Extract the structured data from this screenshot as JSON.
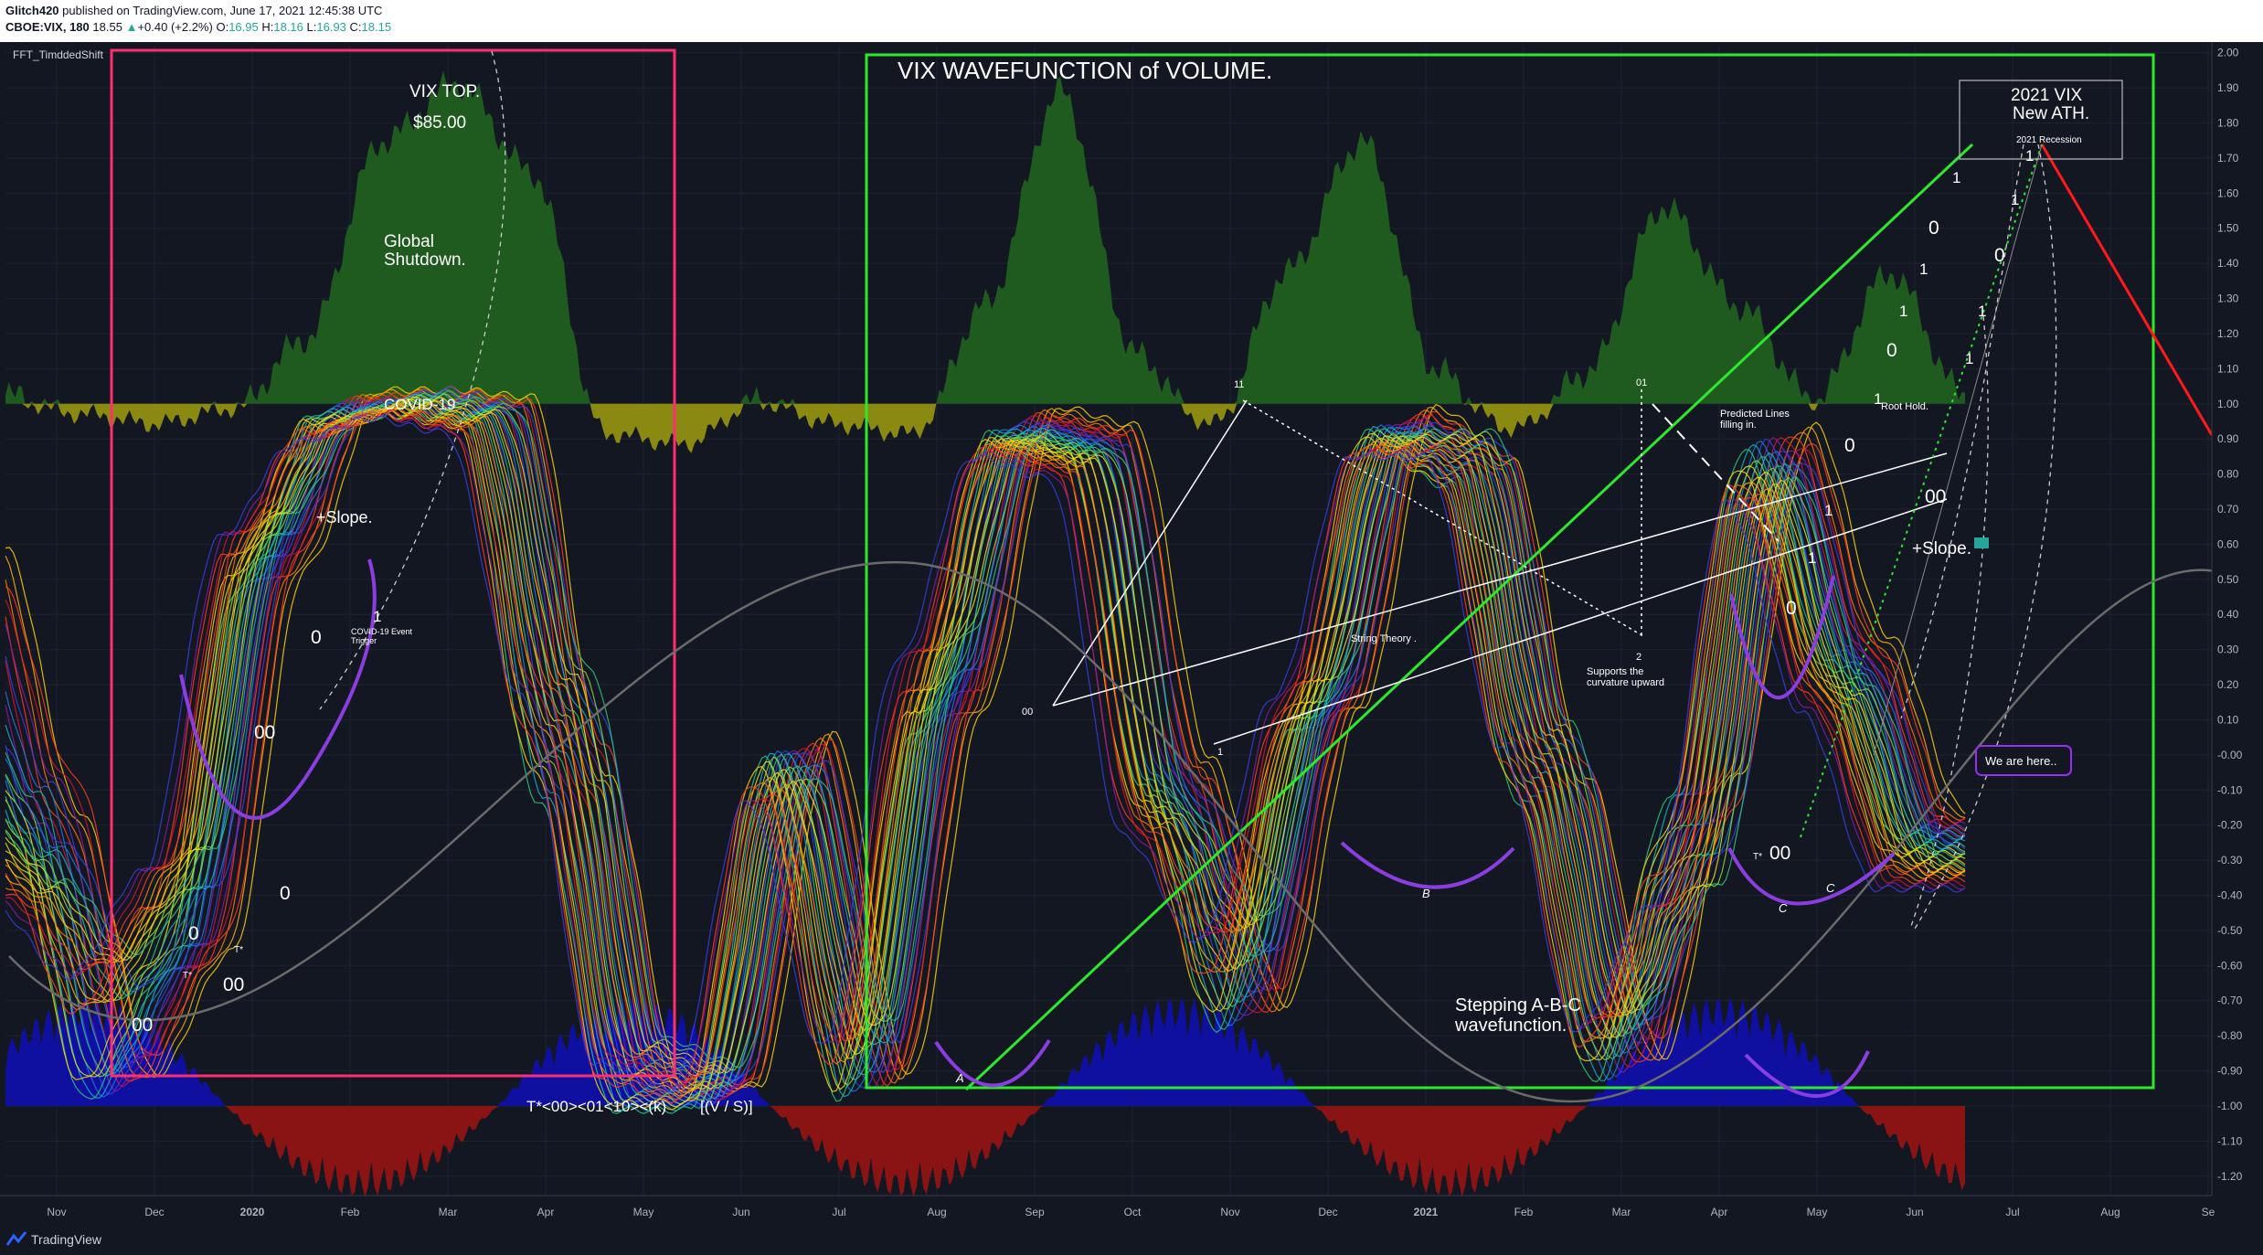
{
  "header": {
    "author": "Glitch420",
    "published": "published on TradingView.com, June 17, 2021 12:45:38 UTC",
    "symbol": "CBOE:VIX, 180",
    "price": "18.55",
    "change": "+0.40 (+2.2%)",
    "open_label": "O:",
    "open": "16.95",
    "high_label": "H:",
    "high": "18.16",
    "low_label": "L:",
    "low": "16.93",
    "close_label": "C:",
    "close": "18.15"
  },
  "indicator_label": "FFT_TimddedShift",
  "footer": {
    "brand": "TradingView"
  },
  "colors": {
    "background": "#131722",
    "pink_box": "#ff2e6f",
    "green_box": "#2ee82e",
    "volume_up": "#1f5a1f",
    "volume_down": "#8a8a12",
    "blue_area": "#1010a0",
    "red_area": "#8a1414",
    "red_line": "#ff1a1a",
    "purple": "#8a3ee0"
  },
  "chart_data": {
    "type": "line",
    "title": "",
    "xlabel": "",
    "ylabel": "",
    "x_ticks": [
      "Nov",
      "Dec",
      "2020",
      "Feb",
      "Mar",
      "Apr",
      "May",
      "Jun",
      "Jul",
      "Aug",
      "Sep",
      "Oct",
      "Nov",
      "Dec",
      "2021",
      "Feb",
      "Mar",
      "Apr",
      "May",
      "Jun",
      "Jul",
      "Aug",
      "Se"
    ],
    "y_ticks": [
      "2.00",
      "1.90",
      "1.80",
      "1.70",
      "1.60",
      "1.50",
      "1.40",
      "1.30",
      "1.20",
      "1.10",
      "1.00",
      "0.90",
      "0.80",
      "0.70",
      "0.60",
      "0.50",
      "0.40",
      "0.30",
      "0.20",
      "0.10",
      "-0.00",
      "-0.10",
      "-0.20",
      "-0.30",
      "-0.40",
      "-0.50",
      "-0.60",
      "-0.70",
      "-0.80",
      "-0.90",
      "-1.00",
      "-1.10",
      "-1.20"
    ],
    "ylim": [
      -1.25,
      2.02
    ],
    "grid": true,
    "series": [
      {
        "values": [
          0.55,
          -0.2,
          -0.95,
          -0.6,
          0.5,
          1.0,
          1.0,
          0.98,
          -0.1,
          -0.98,
          -0.98,
          0.02,
          -0.95,
          0.1,
          0.95,
          0.9,
          -0.05,
          -0.75,
          0.1,
          0.95,
          0.8,
          -0.1,
          -0.9,
          -0.1,
          0.9,
          0.3,
          -0.2
        ]
      },
      {
        "values": [
          0.45,
          -0.1,
          -0.9,
          -0.55,
          0.55,
          0.98,
          1.0,
          0.97,
          0.0,
          -0.96,
          -0.97,
          0.0,
          -0.92,
          0.15,
          0.92,
          0.88,
          -0.1,
          -0.7,
          0.12,
          0.93,
          0.82,
          -0.05,
          -0.85,
          -0.2,
          0.85,
          0.25,
          -0.25
        ]
      },
      {
        "values": [
          0.0,
          -0.3,
          -0.7,
          -0.4,
          0.6,
          0.95,
          1.0,
          0.96,
          0.1,
          -0.9,
          -0.95,
          -0.05,
          -0.85,
          0.2,
          0.9,
          0.85,
          -0.15,
          -0.6,
          0.15,
          0.9,
          0.85,
          0.0,
          -0.8,
          -0.3,
          0.8,
          0.2,
          -0.3
        ]
      },
      {
        "values": [
          -0.2,
          -0.4,
          -0.6,
          -0.3,
          0.65,
          0.92,
          0.99,
          0.95,
          0.2,
          -0.85,
          -0.92,
          -0.1,
          -0.8,
          0.3,
          0.88,
          0.82,
          -0.2,
          -0.5,
          0.2,
          0.88,
          0.88,
          0.05,
          -0.75,
          -0.4,
          0.75,
          0.15,
          -0.35
        ]
      }
    ],
    "volume": {
      "values": [
        0.05,
        -0.1,
        -0.2,
        -0.05,
        0.4,
        1.6,
        1.95,
        1.4,
        -0.3,
        -0.4,
        0.02,
        -0.2,
        -0.3,
        0.6,
        1.9,
        0.3,
        -0.2,
        0.8,
        1.6,
        0.2,
        -0.25,
        0.2,
        1.2,
        0.6,
        0.02,
        0.8,
        0.05
      ]
    },
    "annotations": [
      "VIX TOP.",
      "$85.00",
      "Global Shutdown.",
      "COVID-19",
      "+Slope.",
      "COVID-19 Event Trigger",
      "VIX WAVEFUNCTION of VOLUME.",
      "String Theory .",
      "Supports the curvature upward",
      "Predicted Lines filling in.",
      "Root Hold.",
      "2021 VIX New ATH.",
      "2021 Recession",
      "We are here..",
      "Stepping A-B-C wavefunction.",
      "T*<00><01<10><(k)",
      "[(V / S)]"
    ]
  },
  "labels": {
    "vix_top": "VIX TOP.",
    "vix_price": "$85.00",
    "global1": "Global",
    "global2": "Shutdown.",
    "covid": "COVID-19",
    "slope1": "+Slope.",
    "trig1": "COVID-19  Event",
    "trig2": "Trigger",
    "wave_title": "VIX WAVEFUNCTION of VOLUME.",
    "string": "String Theory .",
    "supports1": "Supports the",
    "supports2": "curvature upward",
    "pred1": "Predicted  Lines",
    "pred2": "filling in.",
    "root": "Root Hold.",
    "ath1": "2021 VIX",
    "ath2": "New ATH.",
    "recession": "2021 Recession",
    "here": "We are here..",
    "step1": "Stepping A-B-C",
    "step2": "wavefunction.",
    "formula": "T*<00><01<10><(k)",
    "vs": "[(V / S)]",
    "slope2": "+Slope.",
    "A": "A",
    "B": "B",
    "C1": "C",
    "C2": "C",
    "n00a": "00",
    "n00b": "00",
    "n00c": "00",
    "n00d": "00",
    "n00e": "00",
    "n00f": "00",
    "n0a": "0",
    "n0b": "0",
    "n0c": "0",
    "n0d": "0",
    "n0e": "0",
    "n0f": "0",
    "n0g": "0",
    "n0h": "0",
    "n1a": "1",
    "n1b": "1",
    "n1c": "1",
    "n1d": "1",
    "n1e": "1",
    "n1f": "1",
    "n1g": "1",
    "n1h": "1",
    "n1i": "1",
    "n1j": "1",
    "n1k": "1",
    "n1l": "1",
    "n11": "11",
    "n01": "01",
    "n2": "2",
    "tstar1": "T*",
    "tstar2": "T*",
    "tstar3": "T*"
  }
}
